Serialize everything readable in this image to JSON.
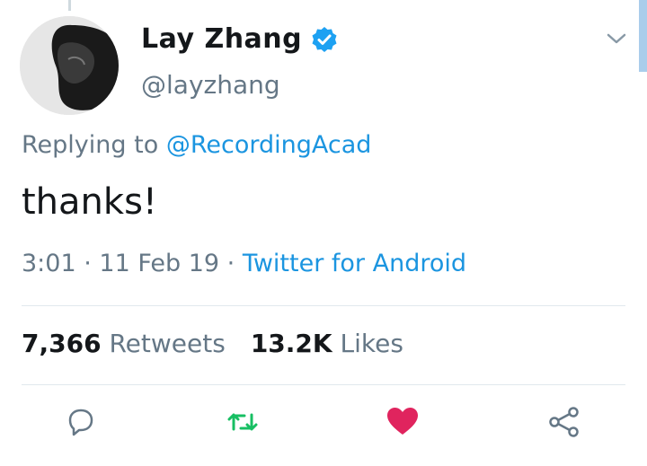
{
  "tweet": {
    "display_name": "Lay Zhang",
    "handle": "@layzhang",
    "replying_prefix": "Replying to",
    "replying_to": "@RecordingAcad",
    "text": "thanks!",
    "time": "3:01",
    "date": "11 Feb 19",
    "separator": " · ",
    "source": "Twitter for Android",
    "retweets_count": "7,366",
    "retweets_label": "Retweets",
    "likes_count": "13.2K",
    "likes_label": "Likes"
  },
  "icons": {
    "verified": "verified-badge-icon",
    "menu": "chevron-down-icon",
    "reply": "reply-icon",
    "retweet": "retweet-icon",
    "like": "heart-icon",
    "share": "share-icon"
  },
  "colors": {
    "link": "#1b95e0",
    "muted": "#657786",
    "retweet": "#17bf63",
    "like": "#e0245e",
    "verified": "#1da1f2"
  }
}
